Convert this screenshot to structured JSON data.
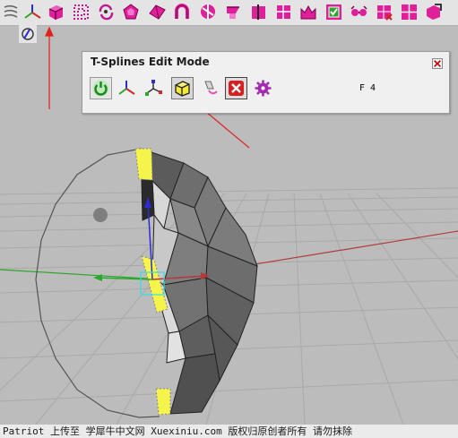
{
  "toolbar": {
    "icons": [
      "curve-icon",
      "axis-tripod-icon",
      "tsplines-cube-icon",
      "grid-points-icon",
      "rotate-arrows-icon",
      "pentagon-icon",
      "fold-icon",
      "magnet-icon",
      "twist-icon",
      "loft-icon",
      "slice-icon",
      "bridge-icon",
      "crown-icon",
      "select-box-icon",
      "goggles-icon",
      "grid-x-icon",
      "window-grid-icon",
      "arrow-cube-icon"
    ]
  },
  "tsplines_panel": {
    "title": "T-Splines Edit Mode",
    "shortcut_text": "F 4",
    "buttons": [
      "power-toggle-button",
      "move-manipulator-button",
      "scale-manipulator-button",
      "edit-cube-button",
      "eraser-button",
      "exit-mode-button",
      "settings-gear-button"
    ]
  },
  "status_bar": {
    "text": "Patriot 上传至 学犀牛中文网 Xuexiniu.com 版权归原创者所有 请勿抹除"
  },
  "colors": {
    "viewport_bg": "#bcbcbc",
    "grid": "#a9a9a9",
    "selection_yellow": "#f4f44a",
    "x_axis": "#b23a3a",
    "y_axis": "#2aa82a",
    "z_axis": "#2b2bd8",
    "annotation_arrow": "#e02020"
  }
}
